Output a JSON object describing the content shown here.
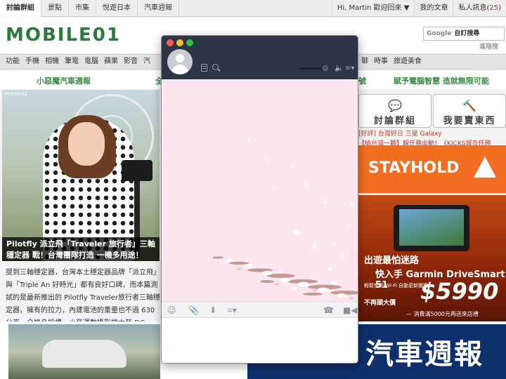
{
  "topnav": {
    "left_tabs": [
      "討論群組",
      "景點",
      "市集",
      "悅遊日本",
      "汽車週報"
    ],
    "greeting": "Hi, Martin 歡迎回來",
    "my_articles": "我的文章",
    "private_messages": "私人訊息",
    "message_count": "25"
  },
  "header": {
    "logo": "MOBILE01",
    "search_provider": "Google",
    "search_label": "自訂搜尋",
    "advanced_search": "進階搜"
  },
  "catnav": {
    "left": [
      "功能",
      "手機",
      "相機",
      "筆電",
      "電腦",
      "蘋果",
      "影音",
      "汽"
    ],
    "right": [
      "聊",
      "時事",
      "旅遊美食"
    ]
  },
  "promo": {
    "left": "小惡魔汽車週報",
    "mid": "全",
    "mid2": "號",
    "right": "賦予電腦智慧 造就無限可能"
  },
  "feature": {
    "watermark": "Mobile01",
    "caption": "Pilotfly 派立飛「Traveler 旅行者」三軸穩定器 戰！台灣團隊打造 一機多用途！",
    "text": "提到三軸穩定器，台灣本土穩定器品牌「派立飛」與「Triple An 好時光」都有良好口碑，而本篇測試的是最新推出的 Pilotfly Traveler旅行者三軸穩定器，擁有的拉力，內建電池的重量也不過 630公克，全機身採構，小至運動攝影機大至 DC..."
  },
  "tiles": [
    {
      "label": "討論群組",
      "icon": "chat-bubble-icon"
    },
    {
      "label": "我要賣東西",
      "icon": "gavel-icon"
    }
  ],
  "news_lines": [
    "[好評] 台灣好日 三星 Galaxy",
    "【給台灣一顆】解任務出動！《KICKS城市任務"
  ],
  "ads": {
    "stayhold": "STAYHOLD",
    "garmin_line1": "出遊最怕迷路",
    "garmin_line2": "快入手 Garmin DriveSmart 51",
    "garmin_line3": "輕鬆使用 Wi-Fi 自動更新圖資",
    "garmin_line4": "不再頭大價",
    "garmin_price": "$5990",
    "garmin_line5": "— 消費滿5000元再送來店禮"
  },
  "bottom_banner": {
    "title": "汽車週報"
  },
  "chat": {
    "input_value": "",
    "colors": {
      "header": "#2c3446",
      "background": "#fde6f0",
      "toolbar": "#f1f1f3"
    }
  }
}
